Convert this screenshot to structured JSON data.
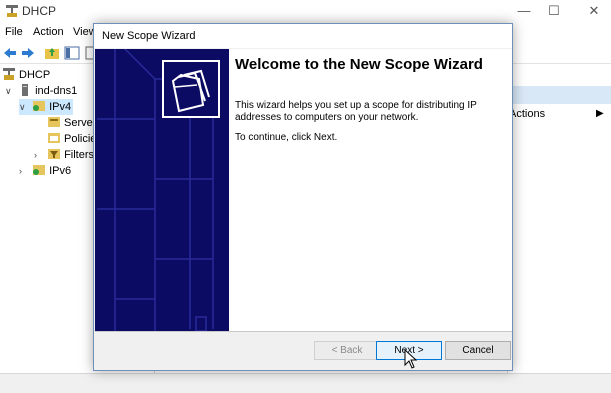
{
  "window": {
    "title": "DHCP",
    "controls": {
      "minimize": "—",
      "maximize": "☐",
      "close": "✕"
    }
  },
  "menu": [
    "File",
    "Action",
    "View"
  ],
  "tree": {
    "root": "DHCP",
    "server": "ind-dns1",
    "ipv4": "IPv4",
    "ipv4_children": [
      "Server",
      "Policie",
      "Filters"
    ],
    "ipv6": "IPv6"
  },
  "actions_pane": {
    "item": "Actions"
  },
  "wizard": {
    "title": "New Scope Wizard",
    "heading": "Welcome to the New Scope Wizard",
    "description": "This wizard helps you set up a scope for distributing IP addresses to computers on your network.",
    "continue_text": "To continue, click Next.",
    "buttons": {
      "back": "< Back",
      "next": "Next >",
      "cancel": "Cancel"
    }
  },
  "colors": {
    "wizard_side": "#0b0b63",
    "accent": "#0078d7"
  }
}
